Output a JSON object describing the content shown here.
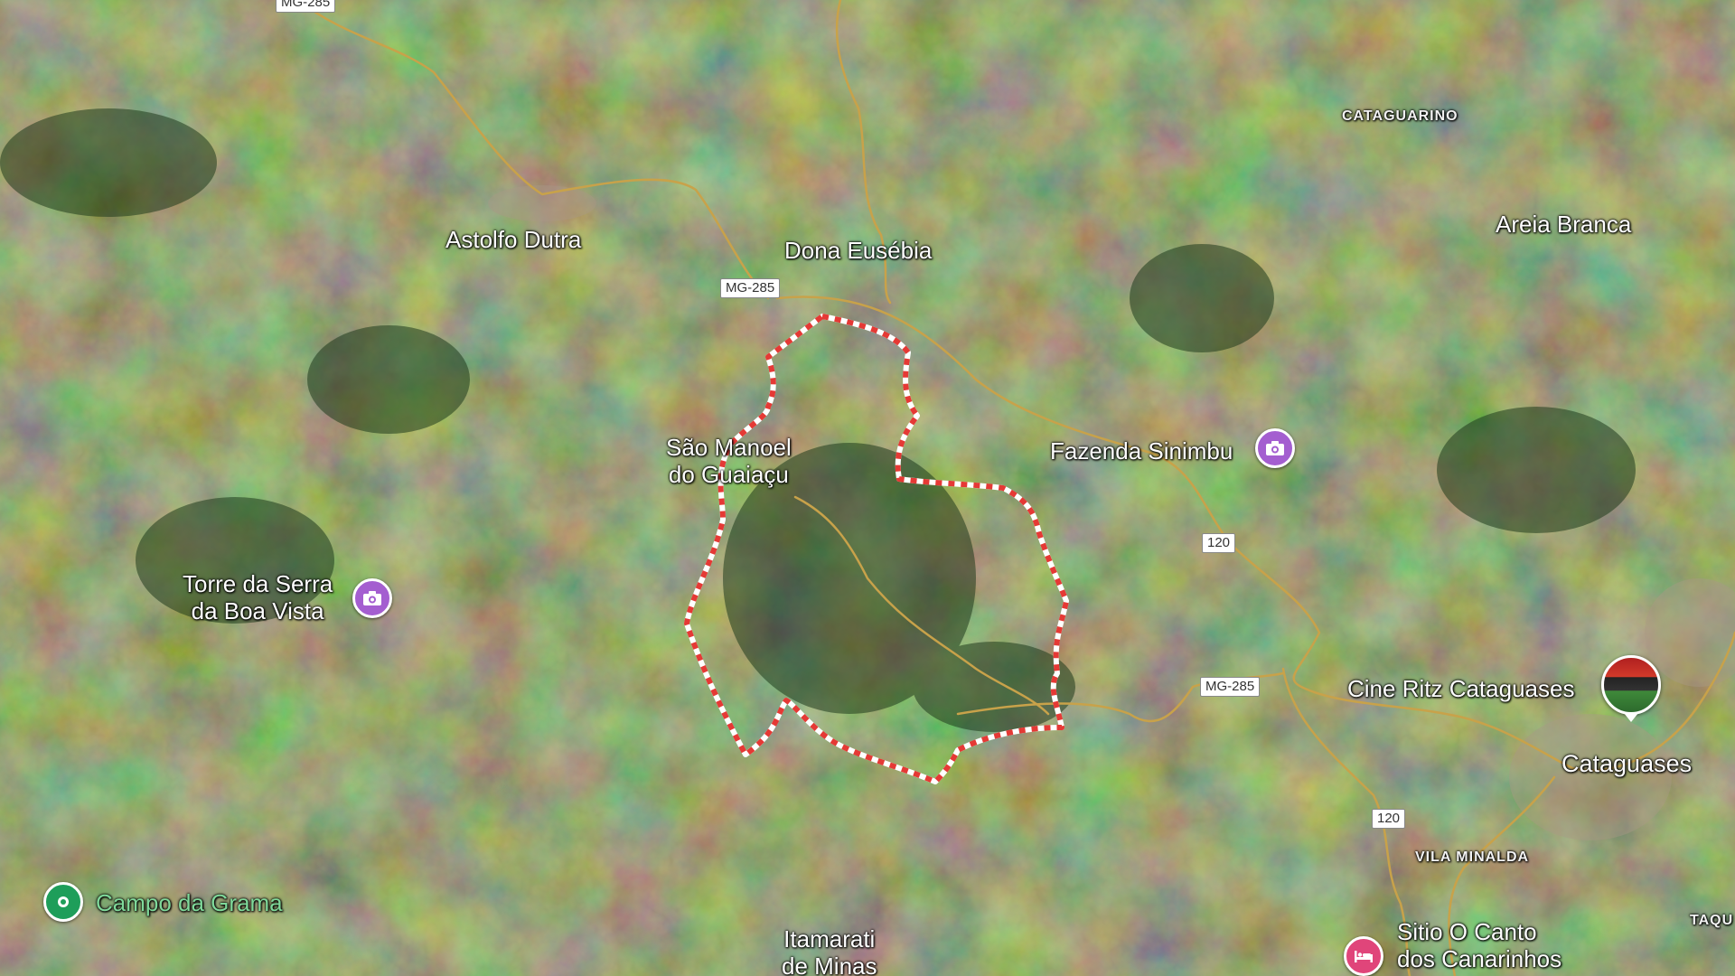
{
  "map": {
    "type": "satellite",
    "colors": {
      "boundary": "#e53935",
      "road": "#c8a24a",
      "poi_purple": "#a45ed0",
      "poi_pink": "#e0457a",
      "pin_green": "#1e9e5a"
    }
  },
  "towns": {
    "astolfo_dutra": "Astolfo Dutra",
    "dona_eusebia": "Dona Eusébia",
    "areia_branca": "Areia Branca",
    "sao_manoel_line1": "São Manoel",
    "sao_manoel_line2": "do Guaiaçu",
    "cataguases": "Cataguases",
    "itamarati_line1": "Itamarati",
    "itamarati_line2": "de Minas"
  },
  "districts": {
    "cataguarino": "CATAGUARINO",
    "vila_minalda": "VILA MINALDA",
    "taqu": "TAQU"
  },
  "pois": {
    "fazenda_sinimbu": "Fazenda Sinimbu",
    "torre_line1": "Torre da Serra",
    "torre_line2": "da Boa Vista",
    "cine_ritz": "Cine Ritz Cataguases",
    "campo_grama": "Campo da Grama",
    "sitio_line1": "Sitio O Canto",
    "sitio_line2": "dos Canarinhos"
  },
  "roads": {
    "mg285_top": "MG-285",
    "mg285_mid": "MG-285",
    "mg285_right": "MG-285",
    "br120_a": "120",
    "br120_b": "120"
  },
  "icons": {
    "camera": "camera-icon",
    "map_pin": "map-pin-icon",
    "bed": "bed-icon",
    "photo": "photo-thumbnail-icon"
  }
}
